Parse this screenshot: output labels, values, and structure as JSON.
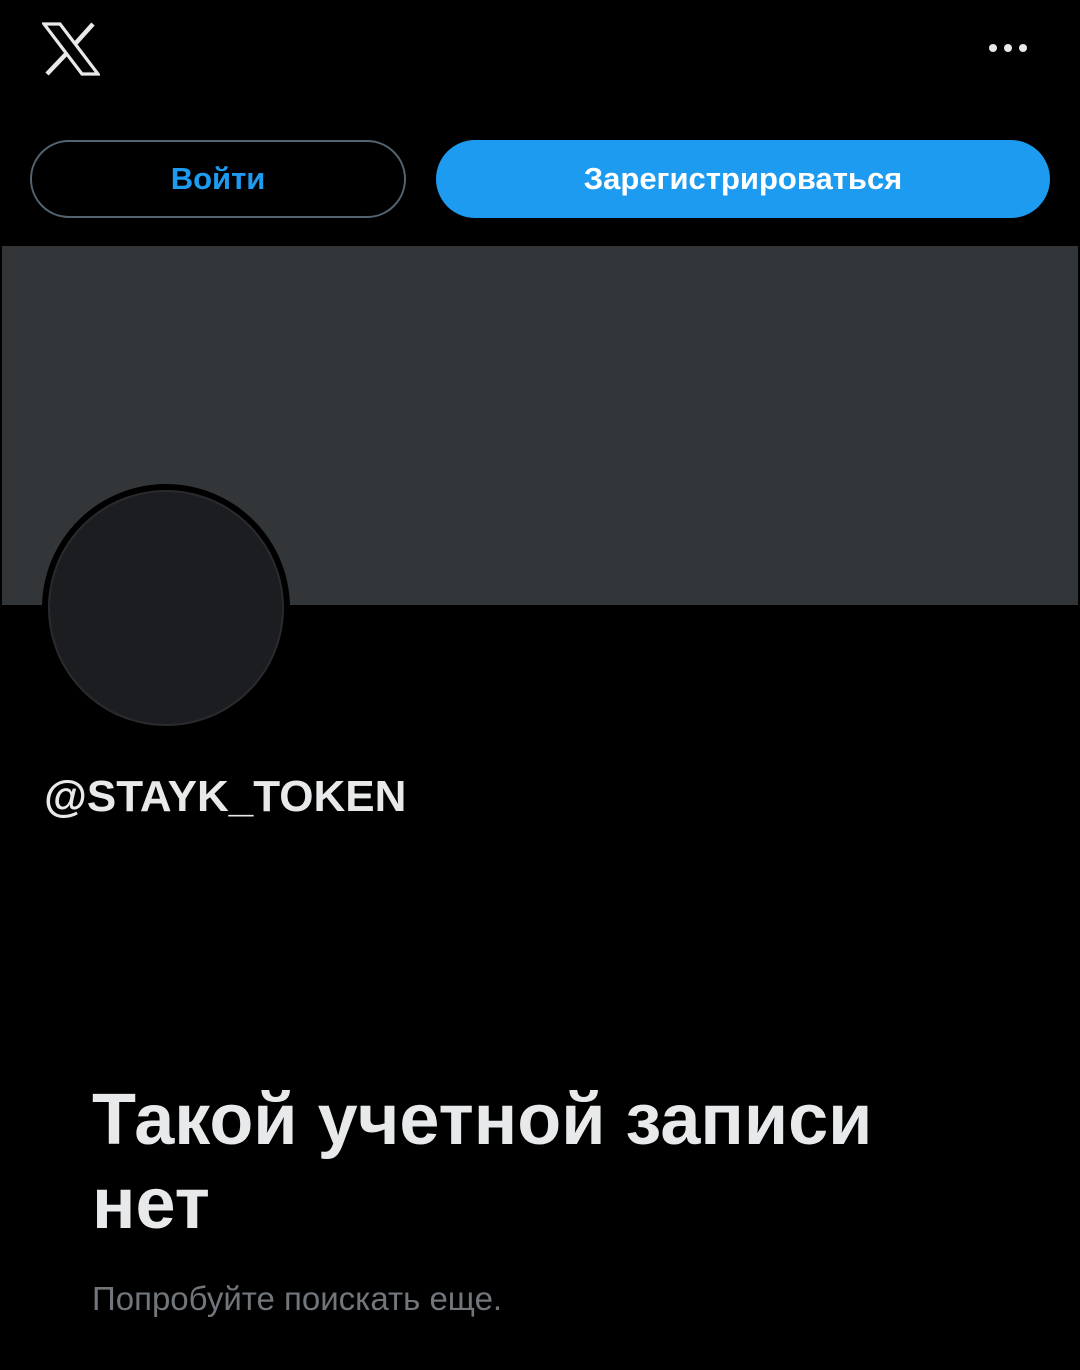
{
  "header": {
    "logo_icon": "x-logo-icon",
    "more_icon": "more-horizontal-icon"
  },
  "auth": {
    "login_label": "Войти",
    "signup_label": "Зарегистрироваться"
  },
  "profile": {
    "handle": "@STAYK_TOKEN"
  },
  "empty_state": {
    "title": "Такой учетной записи нет",
    "subtitle": "Попробуйте поискать еще."
  },
  "colors": {
    "background": "#000000",
    "accent": "#1d9bf0",
    "banner": "#333639",
    "secondary_text": "#71767b"
  }
}
